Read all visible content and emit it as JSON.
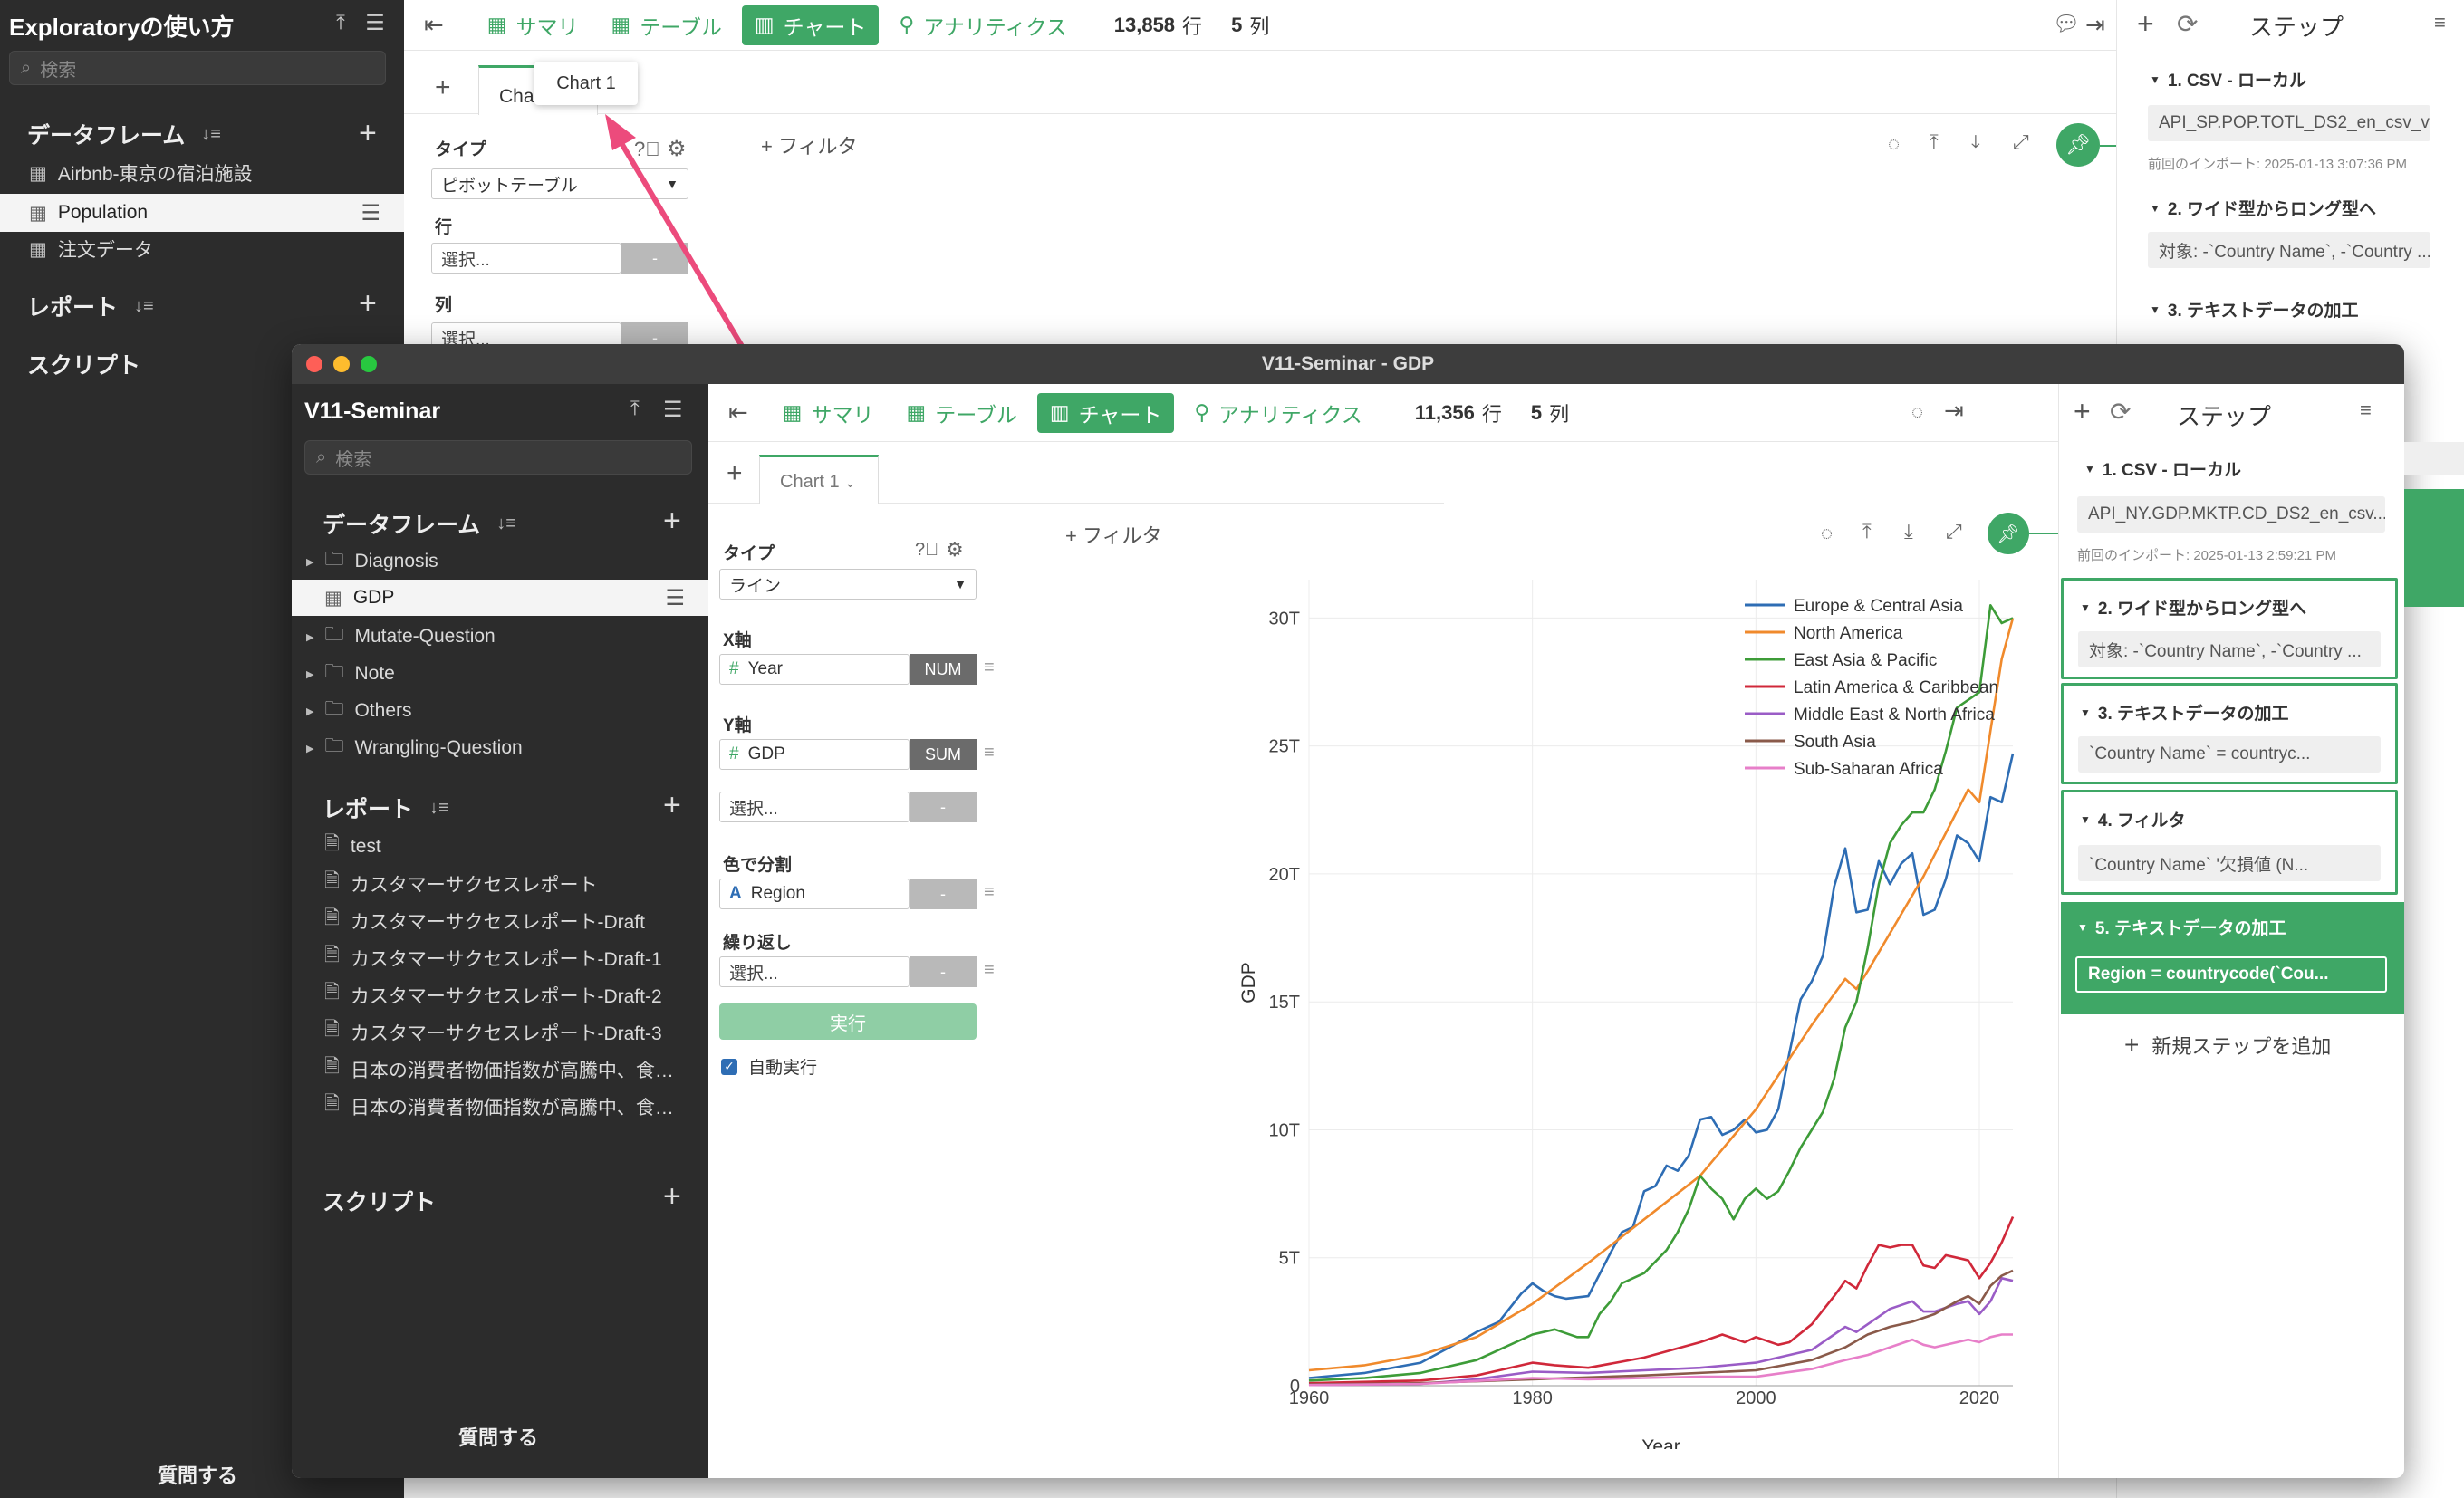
{
  "back": {
    "title": "Exploratoryの使い方",
    "search_placeholder": "検索",
    "dataframes_header": "データフレーム",
    "dataframes": [
      "Airbnb-東京の宿泊施設",
      "Population",
      "注文データ"
    ],
    "reports_header": "レポート",
    "scripts_header": "スクリプト",
    "ask": "質問する",
    "tabs": [
      "サマリ",
      "テーブル",
      "チャート",
      "アナリティクス"
    ],
    "rows": "13,858",
    "rows_unit": "行",
    "cols": "5",
    "cols_unit": "列",
    "chart_tab": "Chart 1",
    "tooltip": "Chart 1",
    "filter": "フィルタ",
    "type_label": "タイプ",
    "type_value": "ピボットテーブル",
    "row_label": "行",
    "col_label": "列",
    "select": "選択...",
    "dash": "-",
    "steps_title": "ステップ",
    "step1": "1. CSV - ローカル",
    "step1_file": "API_SP.POP.TOTL_DS2_en_csv_v2_...",
    "step1_import": "前回のインポート: 2025-01-13 3:07:36 PM",
    "step2": "2. ワイド型からロング型へ",
    "step2_body": "対象: -`Country Name`, -`Country ...",
    "step3": "3. テキストデータの加工"
  },
  "front": {
    "window_title": "V11-Seminar - GDP",
    "project": "V11-Seminar",
    "search_placeholder": "検索",
    "dataframes_header": "データフレーム",
    "tree": [
      {
        "label": "Diagnosis",
        "kind": "folder"
      },
      {
        "label": "GDP",
        "kind": "table"
      },
      {
        "label": "Mutate-Question",
        "kind": "folder"
      },
      {
        "label": "Note",
        "kind": "folder"
      },
      {
        "label": "Others",
        "kind": "folder"
      },
      {
        "label": "Wrangling-Question",
        "kind": "folder"
      }
    ],
    "reports_header": "レポート",
    "reports": [
      "test",
      "カスタマーサクセスレポート",
      "カスタマーサクセスレポート-Draft",
      "カスタマーサクセスレポート-Draft-1",
      "カスタマーサクセスレポート-Draft-2",
      "カスタマーサクセスレポート-Draft-3",
      "日本の消費者物価指数が高騰中、食…",
      "日本の消費者物価指数が高騰中、食…"
    ],
    "scripts_header": "スクリプト",
    "ask": "質問する",
    "tabs": [
      "サマリ",
      "テーブル",
      "チャート",
      "アナリティクス"
    ],
    "rows": "11,356",
    "rows_unit": "行",
    "cols": "5",
    "cols_unit": "列",
    "chart_tab": "Chart 1",
    "filter": "フィルタ",
    "config": {
      "type_label": "タイプ",
      "type_value": "ライン",
      "x_label": "X軸",
      "x_field": "Year",
      "x_agg": "NUM",
      "y_label": "Y軸",
      "y_field": "GDP",
      "y_agg": "SUM",
      "select": "選択...",
      "dash": "-",
      "color_label": "色で分割",
      "color_field": "Region",
      "repeat_label": "繰り返し",
      "run": "実行",
      "auto_run": "自動実行"
    },
    "steps_title": "ステップ",
    "steps": [
      {
        "title": "1. CSV - ローカル",
        "body": "API_NY.GDP.MKTP.CD_DS2_en_csv...",
        "note": "前回のインポート: 2025-01-13 2:59:21 PM"
      },
      {
        "title": "2. ワイド型からロング型へ",
        "body": "対象: -`Country Name`, -`Country ..."
      },
      {
        "title": "3. テキストデータの加工",
        "body": "`Country Name` = countryc..."
      },
      {
        "title": "4. フィルタ",
        "body": "`Country Name` '欠損値 (N..."
      },
      {
        "title": "5. テキストデータの加工",
        "body": "Region = countrycode(`Cou..."
      }
    ],
    "add_step": "新規ステップを追加"
  },
  "colors": {
    "accent": "#3fa766",
    "europe": "#2e6db4",
    "north_america": "#f08a2c",
    "east_asia": "#3d9c38",
    "latin": "#d0283a",
    "mena": "#9a5cc6",
    "south_asia": "#8a5a4a",
    "ssa": "#e77fc9",
    "arrow": "#ec4b7c"
  },
  "chart_data": {
    "type": "line",
    "title": "",
    "xlabel": "Year",
    "ylabel": "GDP",
    "xlim": [
      1960,
      2023
    ],
    "ylim": [
      0,
      32
    ],
    "yticks": [
      {
        "v": 0,
        "label": "0"
      },
      {
        "v": 5,
        "label": "5T"
      },
      {
        "v": 10,
        "label": "10T"
      },
      {
        "v": 15,
        "label": "15T"
      },
      {
        "v": 20,
        "label": "20T"
      },
      {
        "v": 25,
        "label": "25T"
      },
      {
        "v": 30,
        "label": "30T"
      }
    ],
    "xticks": [
      1960,
      1980,
      2000,
      2020
    ],
    "series": [
      {
        "name": "Europe & Central Asia",
        "color": "#2e6db4",
        "points": [
          [
            1960,
            0.3
          ],
          [
            1965,
            0.5
          ],
          [
            1970,
            0.9
          ],
          [
            1973,
            1.6
          ],
          [
            1975,
            2.1
          ],
          [
            1977,
            2.5
          ],
          [
            1979,
            3.6
          ],
          [
            1980,
            4.0
          ],
          [
            1981,
            3.7
          ],
          [
            1982,
            3.5
          ],
          [
            1983,
            3.4
          ],
          [
            1985,
            3.5
          ],
          [
            1987,
            5.2
          ],
          [
            1988,
            6.0
          ],
          [
            1989,
            6.2
          ],
          [
            1990,
            7.6
          ],
          [
            1991,
            7.8
          ],
          [
            1992,
            8.6
          ],
          [
            1993,
            8.4
          ],
          [
            1994,
            9.0
          ],
          [
            1995,
            10.4
          ],
          [
            1996,
            10.5
          ],
          [
            1997,
            9.8
          ],
          [
            1998,
            10.0
          ],
          [
            1999,
            10.4
          ],
          [
            2000,
            9.9
          ],
          [
            2001,
            10.0
          ],
          [
            2002,
            10.8
          ],
          [
            2003,
            13.0
          ],
          [
            2004,
            15.1
          ],
          [
            2005,
            15.8
          ],
          [
            2006,
            16.8
          ],
          [
            2007,
            19.5
          ],
          [
            2008,
            21.0
          ],
          [
            2009,
            18.5
          ],
          [
            2010,
            18.6
          ],
          [
            2011,
            20.5
          ],
          [
            2012,
            19.6
          ],
          [
            2013,
            20.4
          ],
          [
            2014,
            20.8
          ],
          [
            2015,
            18.4
          ],
          [
            2016,
            18.6
          ],
          [
            2017,
            19.8
          ],
          [
            2018,
            21.5
          ],
          [
            2019,
            21.2
          ],
          [
            2020,
            20.5
          ],
          [
            2021,
            23.0
          ],
          [
            2022,
            22.8
          ],
          [
            2023,
            24.7
          ]
        ]
      },
      {
        "name": "North America",
        "color": "#f08a2c",
        "points": [
          [
            1960,
            0.6
          ],
          [
            1965,
            0.8
          ],
          [
            1970,
            1.2
          ],
          [
            1975,
            1.9
          ],
          [
            1980,
            3.2
          ],
          [
            1985,
            4.8
          ],
          [
            1990,
            6.5
          ],
          [
            1995,
            8.2
          ],
          [
            2000,
            10.8
          ],
          [
            2005,
            14.1
          ],
          [
            2008,
            15.9
          ],
          [
            2009,
            15.5
          ],
          [
            2010,
            16.2
          ],
          [
            2015,
            19.9
          ],
          [
            2019,
            23.3
          ],
          [
            2020,
            22.8
          ],
          [
            2021,
            25.6
          ],
          [
            2022,
            28.4
          ],
          [
            2023,
            30.0
          ]
        ]
      },
      {
        "name": "East Asia & Pacific",
        "color": "#3d9c38",
        "points": [
          [
            1960,
            0.2
          ],
          [
            1965,
            0.3
          ],
          [
            1970,
            0.5
          ],
          [
            1975,
            1.0
          ],
          [
            1978,
            1.6
          ],
          [
            1980,
            2.0
          ],
          [
            1982,
            2.2
          ],
          [
            1984,
            1.9
          ],
          [
            1985,
            1.9
          ],
          [
            1986,
            2.8
          ],
          [
            1987,
            3.3
          ],
          [
            1988,
            4.0
          ],
          [
            1990,
            4.4
          ],
          [
            1992,
            5.3
          ],
          [
            1993,
            6.0
          ],
          [
            1994,
            6.9
          ],
          [
            1995,
            8.2
          ],
          [
            1996,
            7.7
          ],
          [
            1997,
            7.3
          ],
          [
            1998,
            6.5
          ],
          [
            1999,
            7.3
          ],
          [
            2000,
            7.7
          ],
          [
            2001,
            7.3
          ],
          [
            2002,
            7.6
          ],
          [
            2003,
            8.4
          ],
          [
            2004,
            9.3
          ],
          [
            2005,
            10.0
          ],
          [
            2006,
            10.7
          ],
          [
            2007,
            12.0
          ],
          [
            2008,
            14.0
          ],
          [
            2009,
            15.0
          ],
          [
            2010,
            17.1
          ],
          [
            2011,
            19.6
          ],
          [
            2012,
            21.2
          ],
          [
            2013,
            21.9
          ],
          [
            2014,
            22.4
          ],
          [
            2015,
            22.4
          ],
          [
            2016,
            23.3
          ],
          [
            2017,
            24.8
          ],
          [
            2018,
            26.5
          ],
          [
            2019,
            26.8
          ],
          [
            2020,
            27.1
          ],
          [
            2021,
            30.5
          ],
          [
            2022,
            29.8
          ],
          [
            2023,
            30.0
          ]
        ]
      },
      {
        "name": "Latin America & Caribbean",
        "color": "#d0283a",
        "points": [
          [
            1960,
            0.1
          ],
          [
            1970,
            0.2
          ],
          [
            1975,
            0.4
          ],
          [
            1980,
            0.9
          ],
          [
            1982,
            0.8
          ],
          [
            1985,
            0.7
          ],
          [
            1990,
            1.1
          ],
          [
            1995,
            1.7
          ],
          [
            1997,
            2.0
          ],
          [
            1999,
            1.7
          ],
          [
            2000,
            1.9
          ],
          [
            2002,
            1.6
          ],
          [
            2003,
            1.7
          ],
          [
            2005,
            2.4
          ],
          [
            2007,
            3.5
          ],
          [
            2008,
            4.1
          ],
          [
            2009,
            3.8
          ],
          [
            2010,
            4.7
          ],
          [
            2011,
            5.5
          ],
          [
            2012,
            5.4
          ],
          [
            2013,
            5.5
          ],
          [
            2014,
            5.5
          ],
          [
            2015,
            4.7
          ],
          [
            2016,
            4.6
          ],
          [
            2017,
            5.1
          ],
          [
            2018,
            5.0
          ],
          [
            2019,
            4.9
          ],
          [
            2020,
            4.2
          ],
          [
            2021,
            4.8
          ],
          [
            2022,
            5.6
          ],
          [
            2023,
            6.6
          ]
        ]
      },
      {
        "name": "Middle East & North Africa",
        "color": "#9a5cc6",
        "points": [
          [
            1960,
            0.03
          ],
          [
            1970,
            0.07
          ],
          [
            1975,
            0.25
          ],
          [
            1980,
            0.55
          ],
          [
            1985,
            0.5
          ],
          [
            1990,
            0.6
          ],
          [
            1995,
            0.7
          ],
          [
            2000,
            0.9
          ],
          [
            2005,
            1.4
          ],
          [
            2008,
            2.3
          ],
          [
            2009,
            2.1
          ],
          [
            2010,
            2.4
          ],
          [
            2012,
            3.0
          ],
          [
            2014,
            3.3
          ],
          [
            2015,
            2.9
          ],
          [
            2016,
            2.9
          ],
          [
            2018,
            3.2
          ],
          [
            2019,
            3.3
          ],
          [
            2020,
            2.8
          ],
          [
            2021,
            3.3
          ],
          [
            2022,
            4.2
          ],
          [
            2023,
            4.1
          ]
        ]
      },
      {
        "name": "South Asia",
        "color": "#8a5a4a",
        "points": [
          [
            1960,
            0.05
          ],
          [
            1970,
            0.1
          ],
          [
            1980,
            0.25
          ],
          [
            1990,
            0.4
          ],
          [
            2000,
            0.6
          ],
          [
            2005,
            1.0
          ],
          [
            2008,
            1.5
          ],
          [
            2010,
            2.0
          ],
          [
            2012,
            2.3
          ],
          [
            2014,
            2.5
          ],
          [
            2016,
            2.8
          ],
          [
            2018,
            3.3
          ],
          [
            2019,
            3.5
          ],
          [
            2020,
            3.2
          ],
          [
            2021,
            3.9
          ],
          [
            2022,
            4.3
          ],
          [
            2023,
            4.5
          ]
        ]
      },
      {
        "name": "Sub-Saharan Africa",
        "color": "#e77fc9",
        "points": [
          [
            1960,
            0.03
          ],
          [
            1970,
            0.07
          ],
          [
            1980,
            0.3
          ],
          [
            1985,
            0.25
          ],
          [
            1990,
            0.3
          ],
          [
            1995,
            0.35
          ],
          [
            2000,
            0.35
          ],
          [
            2005,
            0.65
          ],
          [
            2008,
            1.0
          ],
          [
            2010,
            1.2
          ],
          [
            2012,
            1.5
          ],
          [
            2014,
            1.8
          ],
          [
            2015,
            1.6
          ],
          [
            2016,
            1.5
          ],
          [
            2018,
            1.7
          ],
          [
            2019,
            1.8
          ],
          [
            2020,
            1.7
          ],
          [
            2021,
            1.9
          ],
          [
            2022,
            2.0
          ],
          [
            2023,
            2.0
          ]
        ]
      }
    ]
  }
}
